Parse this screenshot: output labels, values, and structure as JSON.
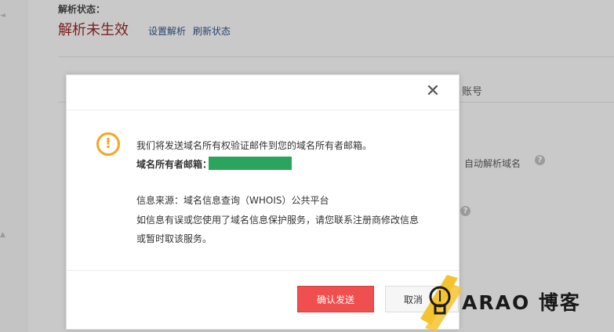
{
  "background": {
    "status_label": "解析状态：",
    "status_value": "解析未生效",
    "links": {
      "setup": "设置解析",
      "refresh": "刷新状态"
    },
    "fragments": {
      "account": "账号",
      "auto_resolve": "自动解析域名"
    }
  },
  "dialog": {
    "message": "我们将发送域名所有权验证邮件到您的域名所有者邮箱。",
    "email_label": "域名所有者邮箱：",
    "info_source": "信息来源：域名信息查询（WHOIS）公共平台",
    "info_line2": "如信息有误或您使用了域名信息保护服务，请您联系注册商修改信息",
    "info_line3": "或暂时取该服务。",
    "confirm_button": "确认发送",
    "cancel_button": "取消",
    "colors": {
      "confirm": "#ef4f4f",
      "warning": "#f5a623",
      "redaction": "#2ba55e"
    }
  },
  "watermark": {
    "text": "ARAO 博客"
  },
  "icons": {
    "close": "close-icon",
    "warning": "warning-icon",
    "help": "help-icon",
    "lightbulb": "lightbulb-icon"
  }
}
